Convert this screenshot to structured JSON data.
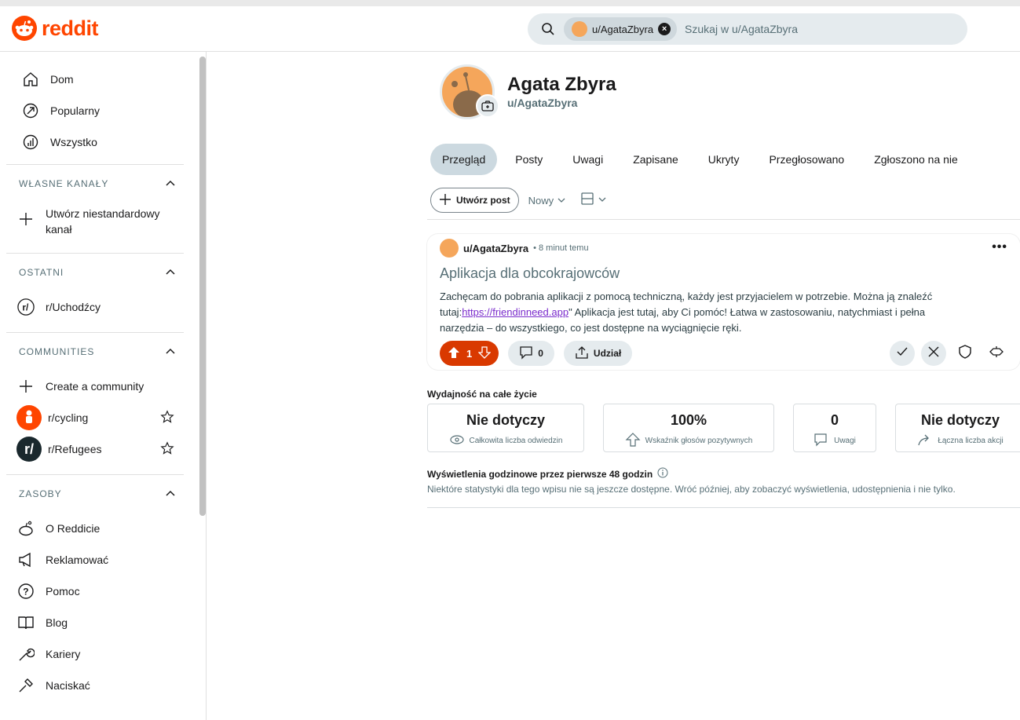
{
  "brand": {
    "name": "reddit",
    "color": "#ff4500"
  },
  "search": {
    "chip_label": "u/AgataZbyra",
    "placeholder": "Szukaj w u/AgataZbyra"
  },
  "sidebar": {
    "main_items": [
      {
        "label": "Dom",
        "icon": "home-icon"
      },
      {
        "label": "Popularny",
        "icon": "popular-icon"
      },
      {
        "label": "Wszystko",
        "icon": "all-icon"
      }
    ],
    "custom_feeds": {
      "title": "WŁASNE KANAŁY",
      "create_label": "Utwórz niestandardowy kanał"
    },
    "recent": {
      "title": "OSTATNI",
      "items": [
        {
          "label": "r/Uchodźcy"
        }
      ]
    },
    "communities": {
      "title": "COMMUNITIES",
      "create_label": "Create a community",
      "items": [
        {
          "label": "r/cycling",
          "color": "#ff4500"
        },
        {
          "label": "r/Refugees",
          "color": "#1a282d"
        }
      ]
    },
    "resources": {
      "title": "ZASOBY",
      "items": [
        {
          "label": "O Reddicie",
          "icon": "reddit-alien-icon"
        },
        {
          "label": "Reklamować",
          "icon": "megaphone-icon"
        },
        {
          "label": "Pomoc",
          "icon": "help-icon"
        },
        {
          "label": "Blog",
          "icon": "book-icon"
        },
        {
          "label": "Kariery",
          "icon": "wrench-icon"
        },
        {
          "label": "Naciskać",
          "icon": "press-icon"
        }
      ]
    }
  },
  "profile": {
    "display_name": "Agata Zbyra",
    "handle": "u/AgataZbyra"
  },
  "tabs": [
    {
      "label": "Przegląd",
      "active": true
    },
    {
      "label": "Posty"
    },
    {
      "label": "Uwagi"
    },
    {
      "label": "Zapisane"
    },
    {
      "label": "Ukryty"
    },
    {
      "label": "Przegłosowano"
    },
    {
      "label": "Zgłoszono na nie"
    }
  ],
  "toolbar": {
    "create_post": "Utwórz post",
    "sort": "Nowy"
  },
  "post": {
    "author": "u/AgataZbyra",
    "time": "• 8 minut temu",
    "title": "Aplikacja dla obcokrajowców",
    "body_pre": "Zachęcam do pobrania aplikacji z pomocą techniczną, każdy jest przyjacielem w potrzebie. Można ją znaleźć tutaj:",
    "link": "https://friendinneed.app",
    "body_post": "\" Aplikacja jest tutaj, aby Ci pomóc! Łatwa w zastosowaniu, natychmiast i pełna narzędzia – do wszystkiego, co jest dostępne na wyciągnięcie ręki.",
    "votes": "1",
    "comments": "0",
    "share": "Udział",
    "vote_color": "#d93900"
  },
  "insights": {
    "title": "Wydajność na całe życie",
    "stats": [
      {
        "value": "Nie dotyczy",
        "label": "Całkowita liczba odwiedzin"
      },
      {
        "value": "100%",
        "label": "Wskaźnik głosów pozytywnych"
      },
      {
        "value": "0",
        "label": "Uwagi"
      },
      {
        "value": "Nie dotyczy",
        "label": "Łączna liczba akcji"
      }
    ],
    "hourly_title": "Wyświetlenia godzinowe przez pierwsze 48 godzin",
    "hourly_note": "Niektóre statystyki dla tego wpisu nie są jeszcze dostępne. Wróć później, aby zobaczyć wyświetlenia, udostępnienia i nie tylko."
  }
}
